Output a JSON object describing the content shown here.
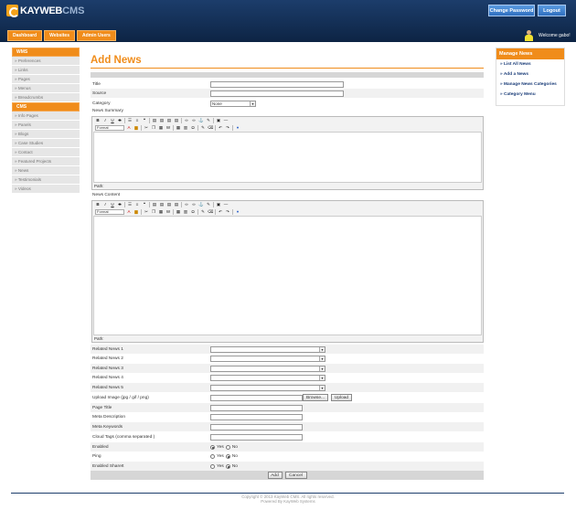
{
  "app": {
    "logo_main": "KAYWEB",
    "logo_sub": "CMS",
    "change_password": "Change Password",
    "logout": "Logout",
    "welcome": "Welcome gabo!"
  },
  "tabs": [
    "Dashboard",
    "Websites",
    "Admin Users"
  ],
  "sidebar": {
    "wms_title": "WMS",
    "wms_items": [
      "» Preferences",
      "» Links",
      "» Pages",
      "» Menus",
      "» Breadcrumbs"
    ],
    "cms_title": "CMS",
    "cms_items": [
      "» Info Pages",
      "» Panels",
      "» Blogs",
      "» Case Studies",
      "» Contact",
      "» Featured Projects",
      "» News",
      "» Testimonials",
      "» Videos"
    ]
  },
  "page": {
    "title": "Add News"
  },
  "form": {
    "title_label": "Title",
    "source_label": "Source",
    "category_label": "Category",
    "category_value": "None",
    "summary_label": "News Summary",
    "content_label": "News Content",
    "path_label": "Path:",
    "format_label": "Format",
    "related": [
      "Related News 1",
      "Related News 2",
      "Related News 3",
      "Related News 4",
      "Related News 5"
    ],
    "upload_label": "Upload Image (jpg / gif / png)",
    "browse": "Browse...",
    "upload_btn": "Upload",
    "page_title_label": "Page Title",
    "meta_desc_label": "Meta Description",
    "meta_kw_label": "Meta Keywords",
    "cloud_label": "Cloud Tags (comma separated )",
    "enabled_label": "Enabled",
    "ping_label": "Ping",
    "sharethis_label": "Enabled ShareIt",
    "yes": "Yes",
    "no": "No",
    "add": "Add",
    "cancel": "Cancel"
  },
  "right": {
    "title": "Manage News",
    "items": [
      "» List All News",
      "» Add a News",
      "» Manage News Categories",
      "» Category Menu"
    ]
  },
  "footer": {
    "copy": "Copyright © 2013 KayWeb CMS. All rights reserved.",
    "powered": "Powered By KayWeb Systems"
  }
}
